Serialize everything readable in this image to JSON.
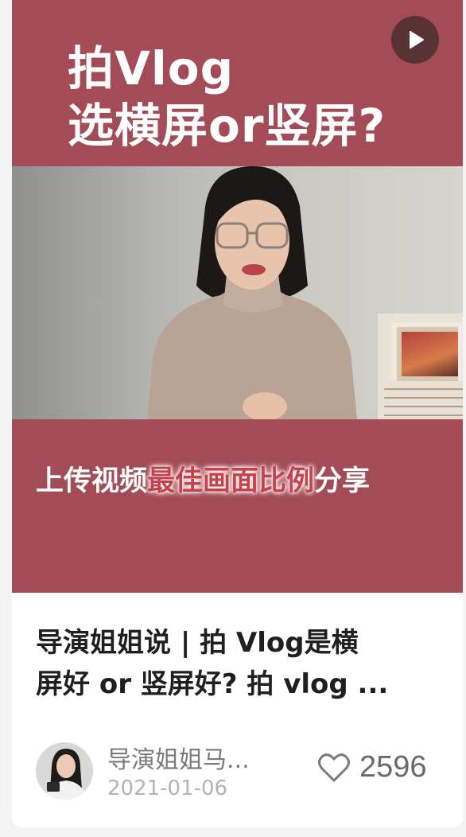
{
  "thumbnail": {
    "headline_line1": "拍Vlog",
    "headline_line2": "选横屏or竖屏?",
    "caption_prefix": "上传视频",
    "caption_highlight": "最佳画面比例",
    "caption_suffix": "分享",
    "play_icon": "play-icon",
    "background_color": "#a34c57"
  },
  "post": {
    "title_line1": "导演姐姐说 | 拍 Vlog是横",
    "title_line2": "屏好 or 竖屏好? 拍 vlog ...",
    "author_name": "导演姐姐马...",
    "date": "2021-01-06",
    "like_icon": "heart-outline-icon",
    "like_count": "2596"
  }
}
